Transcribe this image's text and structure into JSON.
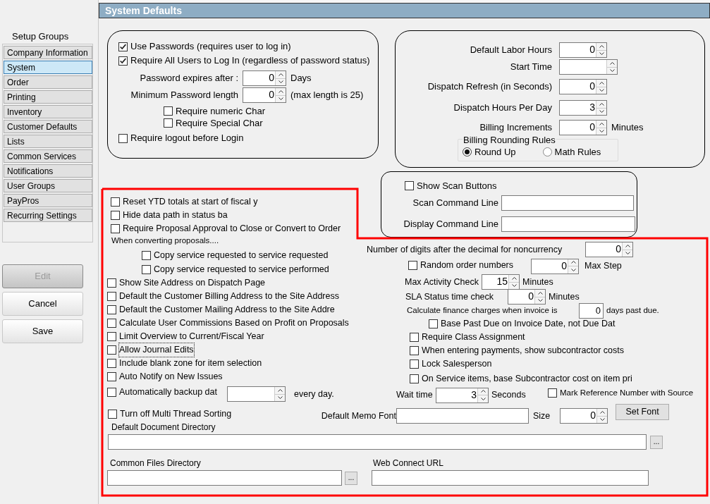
{
  "sidebar": {
    "heading": "Setup Groups",
    "items": [
      {
        "label": "Company Information",
        "selected": false
      },
      {
        "label": "System",
        "selected": true
      },
      {
        "label": "Order",
        "selected": false
      },
      {
        "label": "Printing",
        "selected": false
      },
      {
        "label": "Inventory",
        "selected": false
      },
      {
        "label": "Customer Defaults",
        "selected": false
      },
      {
        "label": "Lists",
        "selected": false
      },
      {
        "label": "Common Services",
        "selected": false
      },
      {
        "label": "Notifications",
        "selected": false
      },
      {
        "label": "User Groups",
        "selected": false
      },
      {
        "label": "PayPros",
        "selected": false
      },
      {
        "label": "Recurring Settings",
        "selected": false
      }
    ]
  },
  "actions": [
    {
      "label": "Edit",
      "disabled": true
    },
    {
      "label": "Cancel",
      "disabled": false
    },
    {
      "label": "Save",
      "disabled": false
    }
  ],
  "panel_title": "System Defaults",
  "security": {
    "options": [
      {
        "label": "Use Passwords (requires user to log in)",
        "checked": true
      },
      {
        "label": "Require All Users to Log In (regardless of password status)",
        "checked": true
      }
    ],
    "password_expires": {
      "label": "Password expires after :",
      "value": "0",
      "unit": "Days"
    },
    "min_length": {
      "label": "Minimum Password length",
      "value": "0",
      "note": "(max length is 25)"
    },
    "requirements": [
      {
        "label": "Require numeric Char",
        "checked": false
      },
      {
        "label": "Require Special Char",
        "checked": false
      }
    ],
    "logout": {
      "label": "Require logout before Login",
      "checked": false
    }
  },
  "dispatch": {
    "fields": [
      {
        "label": "Default Labor Hours",
        "value": "0"
      },
      {
        "label": "Start Time"
      },
      {
        "label": "Dispatch Refresh (in Seconds)",
        "value": "0"
      },
      {
        "label": "Dispatch Hours Per Day",
        "value": "3"
      },
      {
        "label": "Billing Increments",
        "value": "0",
        "unit": "Minutes"
      }
    ],
    "rounding": {
      "title": "Billing Rounding Rules",
      "options": [
        {
          "label": "Round Up",
          "selected": true
        },
        {
          "label": "Math Rules",
          "selected": false
        }
      ]
    }
  },
  "scan": {
    "show": {
      "label": "Show Scan Buttons",
      "checked": false
    },
    "fields": [
      {
        "label": "Scan Command Line"
      },
      {
        "label": "Display Command Line"
      }
    ]
  },
  "left_options": [
    {
      "kind": "checkbox",
      "label": "Reset YTD totals at start of fiscal y",
      "checked": false,
      "focused": false
    },
    {
      "kind": "checkbox",
      "label": "Hide data path in status ba",
      "checked": false,
      "focused": false
    },
    {
      "kind": "checkbox",
      "label": "Require Proposal Approval to Close or Convert to Order",
      "checked": false,
      "focused": false
    },
    {
      "kind": "note",
      "label": "When converting proposals...."
    },
    {
      "kind": "sub_checkbox",
      "label": "Copy service requested to service requested",
      "checked": false,
      "focused": false
    },
    {
      "kind": "sub_checkbox",
      "label": "Copy service requested to service performed",
      "checked": false,
      "focused": false
    },
    {
      "kind": "checkbox",
      "label": "Show Site Address on Dispatch Page",
      "checked": false,
      "focused": false
    },
    {
      "kind": "checkbox",
      "label": "Default the Customer Billing Address to the Site Address",
      "checked": false,
      "focused": false
    },
    {
      "kind": "checkbox",
      "label": "Default the Customer Mailing Address to the Site Addre",
      "checked": false,
      "focused": false
    },
    {
      "kind": "checkbox",
      "label": "Calculate User Commissions Based on Profit on Proposals",
      "checked": false,
      "focused": false
    },
    {
      "kind": "checkbox",
      "label": "Limit Overview to Current/Fiscal Year",
      "checked": false,
      "focused": false
    },
    {
      "kind": "checkbox",
      "label": "Allow Journal Edits",
      "checked": false,
      "focused": true
    },
    {
      "kind": "checkbox",
      "label": "Include blank zone for item selection",
      "checked": false,
      "focused": false
    },
    {
      "kind": "checkbox",
      "label": "Auto Notify on New Issues",
      "checked": false,
      "focused": false
    },
    {
      "kind": "backup",
      "label": "Automatically backup dat",
      "checked": false,
      "focused": false,
      "unit": "every day."
    }
  ],
  "right_options": [
    {
      "kind": "spin",
      "label": "Number of digits after the decimal for noncurrency",
      "value": "0"
    },
    {
      "kind": "check_spin",
      "label": "Random order numbers",
      "checked": false,
      "value": "0",
      "unit": "Max Step"
    },
    {
      "kind": "spin",
      "label": "Max Activity Check",
      "value": "15",
      "unit": "Minutes"
    },
    {
      "kind": "spin",
      "label": "SLA Status time check",
      "value": "0",
      "unit": "Minutes"
    },
    {
      "kind": "field",
      "label": "Calculate finance charges when invoice is",
      "value": "0",
      "unit": "days past due."
    },
    {
      "kind": "checkbox",
      "label": "Base Past Due on Invoice Date, not Due Dat",
      "checked": false
    },
    {
      "kind": "checkbox",
      "label": "Require Class Assignment",
      "checked": false
    },
    {
      "kind": "checkbox",
      "label": "When entering payments, show subcontractor costs",
      "checked": false
    },
    {
      "kind": "checkbox",
      "label": "Lock Salesperson",
      "checked": false
    },
    {
      "kind": "checkbox",
      "label": "On Service items, base Subcontractor cost on item pri",
      "checked": false
    },
    {
      "kind": "wait",
      "label": "Wait time",
      "value": "3",
      "unit": "Seconds",
      "check_label": "Mark Reference Number with Source",
      "checked": false
    }
  ],
  "bottom": {
    "thread_sort": {
      "label": "Turn off Multi Thread Sorting",
      "checked": false
    },
    "memo_font": {
      "label": "Default Memo Font",
      "size_label": "Size",
      "size": "0",
      "button": "Set Font"
    },
    "directories": [
      {
        "label": "Default Document Directory",
        "browse": "..."
      },
      {
        "label": "Common Files Directory",
        "browse": "..."
      },
      {
        "label": "Web Connect URL"
      }
    ]
  }
}
